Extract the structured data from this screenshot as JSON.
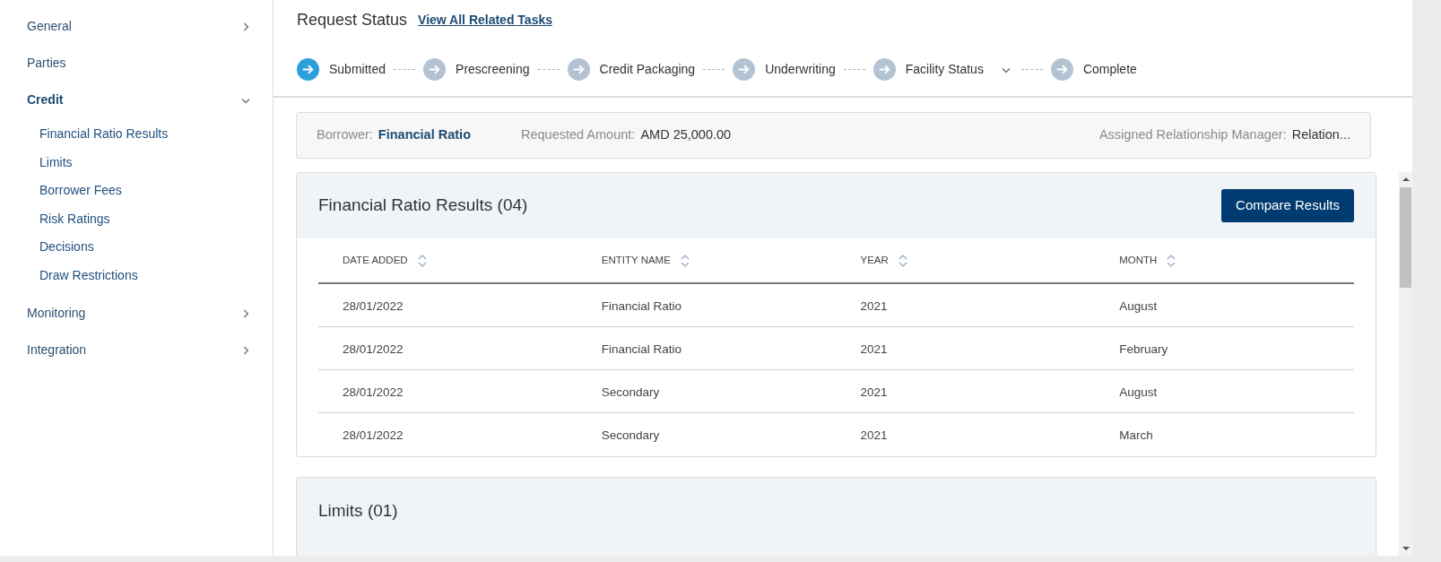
{
  "sidebar": {
    "items": [
      {
        "label": "General",
        "selected": false,
        "expanded": false
      },
      {
        "label": "Parties",
        "selected": false
      },
      {
        "label": "Credit",
        "selected": true,
        "expanded": true,
        "children": [
          {
            "label": "Financial Ratio Results"
          },
          {
            "label": "Limits"
          },
          {
            "label": "Borrower Fees"
          },
          {
            "label": "Risk Ratings"
          },
          {
            "label": "Decisions"
          },
          {
            "label": "Draw Restrictions"
          }
        ]
      },
      {
        "label": "Monitoring",
        "selected": false,
        "expanded": false
      },
      {
        "label": "Integration",
        "selected": false,
        "expanded": false
      }
    ]
  },
  "header": {
    "title": "Request Status",
    "link": "View All Related Tasks"
  },
  "steps": [
    {
      "label": "Submitted",
      "selected": true
    },
    {
      "label": "Prescreening",
      "selected": false
    },
    {
      "label": "Credit Packaging",
      "selected": false
    },
    {
      "label": "Underwriting",
      "selected": false
    },
    {
      "label": "Facility Status",
      "selected": false,
      "expanded": false
    },
    {
      "label": "Complete",
      "selected": false
    }
  ],
  "info_bar": {
    "borrower_label": "Borrower:",
    "borrower": "Financial Ratio",
    "amount_label": "Requested Amount:",
    "amount": "AMD 25,000.00",
    "manager_label": "Assigned Relationship Manager:",
    "manager": "Relation..."
  },
  "financial_ratio_card": {
    "title": "Financial Ratio Results (04)",
    "button": "Compare Results",
    "table": {
      "columns": [
        "DATE ADDED",
        "ENTITY NAME",
        "YEAR",
        "MONTH"
      ],
      "rows": [
        [
          "28/01/2022",
          "Financial Ratio",
          "2021",
          "August"
        ],
        [
          "28/01/2022",
          "Financial Ratio",
          "2021",
          "February"
        ],
        [
          "28/01/2022",
          "Secondary",
          "2021",
          "August"
        ],
        [
          "28/01/2022",
          "Secondary",
          "2021",
          "March"
        ]
      ]
    }
  },
  "limits_card": {
    "title": "Limits (01)"
  }
}
